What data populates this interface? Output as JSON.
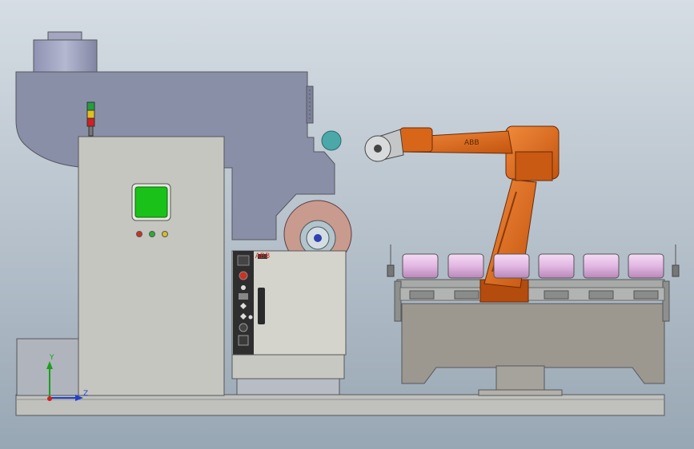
{
  "scene": {
    "background_top": "#d6dde4",
    "background_bottom": "#98a7b4",
    "colors": {
      "press_frame": "#8a8fa8",
      "cabinet": "#c4c6bf",
      "robot": "#e06a1c",
      "robot_dark": "#b44c0e",
      "roll_pink": "#e2b6e2",
      "grinding_wheel": "#c99a8e",
      "screen_green": "#19c119",
      "table_body": "#9c9890",
      "base_plate": "#c0c0bc"
    },
    "robot_badge": "ABB",
    "controller_badge": "ABB",
    "coordinate_triad": {
      "y_label": "Y",
      "z_label": "Z"
    },
    "indicator_lights": [
      "#d03020",
      "#28b030",
      "#d4c020"
    ],
    "signal_tower": [
      "#20a040",
      "#e0c020",
      "#d02020"
    ],
    "roll_count": 6
  }
}
